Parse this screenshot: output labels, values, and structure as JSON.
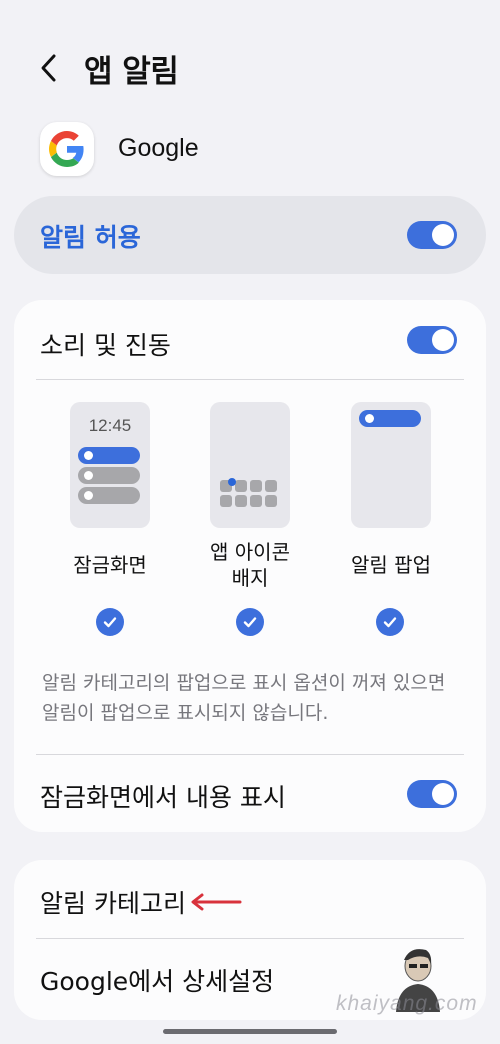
{
  "header": {
    "title": "앱 알림"
  },
  "app": {
    "name": "Google"
  },
  "allow": {
    "label": "알림 허용",
    "enabled": true
  },
  "sound": {
    "label": "소리 및 진동",
    "enabled": true
  },
  "styles": {
    "lock_screen": {
      "time": "12:45",
      "label": "잠금화면",
      "checked": true
    },
    "app_icon_badge": {
      "label_line1": "앱 아이콘",
      "label_line2": "배지",
      "checked": true
    },
    "popup": {
      "label": "알림 팝업",
      "checked": true
    }
  },
  "description": "알림 카테고리의 팝업으로 표시 옵션이 꺼져 있으면 알림이 팝업으로 표시되지 않습니다.",
  "lock_content": {
    "label": "잠금화면에서 내용 표시",
    "enabled": true
  },
  "menu": {
    "categories": "알림 카테고리",
    "google_settings": "Google에서 상세설정"
  },
  "watermark": "khaiyang.com",
  "colors": {
    "accent": "#2a66d8",
    "toggle": "#3d6fdc",
    "arrow": "#d8323c"
  }
}
